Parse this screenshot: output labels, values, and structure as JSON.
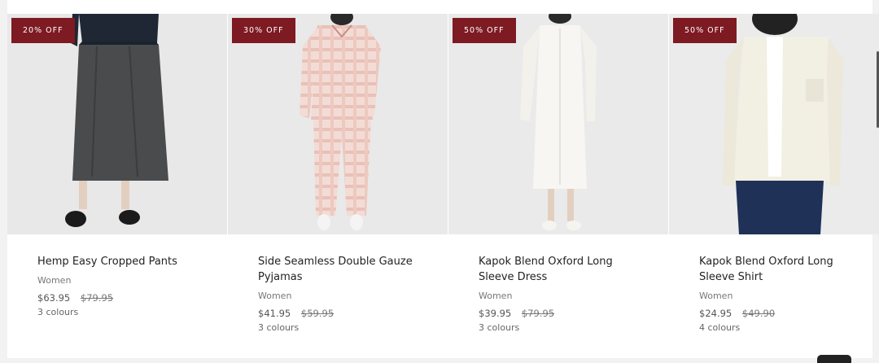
{
  "products": [
    {
      "badge": "20% OFF",
      "name": "Hemp Easy Cropped Pants",
      "category": "Women",
      "price": "$63.95",
      "original_price": "$79.95",
      "colours": "3 colours"
    },
    {
      "badge": "30% OFF",
      "name": "Side Seamless Double Gauze Pyjamas",
      "category": "Women",
      "price": "$41.95",
      "original_price": "$59.95",
      "colours": "3 colours"
    },
    {
      "badge": "50% OFF",
      "name": "Kapok Blend Oxford Long Sleeve Dress",
      "category": "Women",
      "price": "$39.95",
      "original_price": "$79.95",
      "colours": "3 colours"
    },
    {
      "badge": "50% OFF",
      "name": "Kapok Blend Oxford Long Sleeve Shirt",
      "category": "Women",
      "price": "$24.95",
      "original_price": "$49.90",
      "colours": "4 colours"
    }
  ],
  "colors": {
    "badge": "#7d1a22"
  }
}
